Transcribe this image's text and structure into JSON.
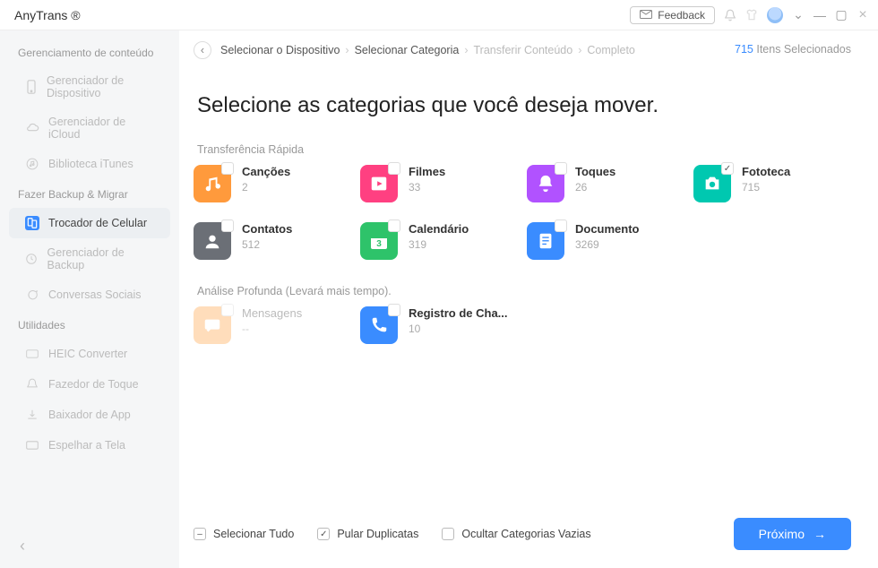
{
  "app": {
    "title": "AnyTrans ®"
  },
  "titlebar": {
    "feedback": "Feedback"
  },
  "sidebar": {
    "section_content": "Gerenciamento de conteúdo",
    "items_content": [
      {
        "label": "Gerenciador de Dispositivo"
      },
      {
        "label": "Gerenciador de iCloud"
      },
      {
        "label": "Biblioteca iTunes"
      }
    ],
    "section_backup": "Fazer Backup & Migrar",
    "items_backup": [
      {
        "label": "Trocador de Celular"
      },
      {
        "label": "Gerenciador de Backup"
      },
      {
        "label": "Conversas Sociais"
      }
    ],
    "section_util": "Utilidades",
    "items_util": [
      {
        "label": "HEIC Converter"
      },
      {
        "label": "Fazedor de Toque"
      },
      {
        "label": "Baixador de App"
      },
      {
        "label": "Espelhar a Tela"
      }
    ]
  },
  "breadcrumb": {
    "s1": "Selecionar o Dispositivo",
    "s2": "Selecionar Categoria",
    "s3": "Transferir Conteúdo",
    "s4": "Completo"
  },
  "selected": {
    "count": "715",
    "label": "Itens Selecionados"
  },
  "page": {
    "title": "Selecione as categorias que você deseja mover."
  },
  "group": {
    "fast": "Transferência Rápida",
    "deep": "Análise Profunda (Levará mais tempo)."
  },
  "cats": {
    "songs": {
      "label": "Canções",
      "count": "2"
    },
    "movies": {
      "label": "Filmes",
      "count": "33"
    },
    "tones": {
      "label": "Toques",
      "count": "26"
    },
    "photos": {
      "label": "Fototeca",
      "count": "715"
    },
    "contacts": {
      "label": "Contatos",
      "count": "512"
    },
    "calendar": {
      "label": "Calendário",
      "count": "319"
    },
    "document": {
      "label": "Documento",
      "count": "3269"
    },
    "messages": {
      "label": "Mensagens",
      "count": "--"
    },
    "calls": {
      "label": "Registro de Cha...",
      "count": "10"
    }
  },
  "footer": {
    "select_all": "Selecionar Tudo",
    "skip_dup": "Pular Duplicatas",
    "hide_empty": "Ocultar Categorias Vazias",
    "next": "Próximo"
  },
  "colors": {
    "songs": "#ff9a3c",
    "movies": "#ff4081",
    "tones": "#b152ff",
    "photos": "#00c8b0",
    "contacts": "#6b6f76",
    "calendar": "#2ec36a",
    "document": "#3a8cff",
    "messages": "#ffb56b",
    "calls": "#3a8cff"
  }
}
